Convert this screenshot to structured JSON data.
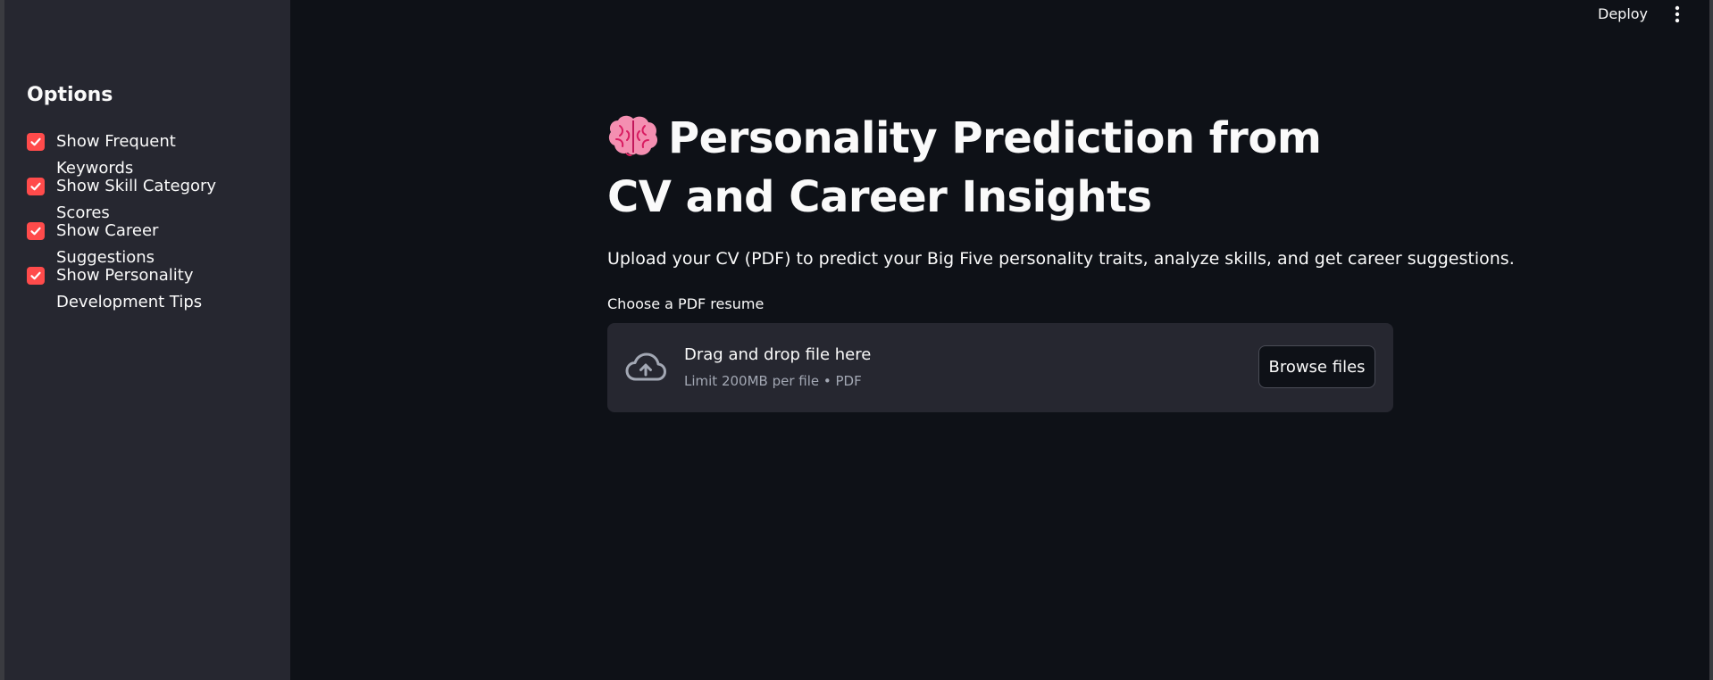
{
  "header": {
    "deploy_label": "Deploy",
    "menu_icon": "kebab-menu-icon"
  },
  "sidebar": {
    "title": "Options",
    "options": [
      {
        "label": "Show Frequent Keywords",
        "checked": true
      },
      {
        "label": "Show Skill Category Scores",
        "checked": true
      },
      {
        "label": "Show Career Suggestions",
        "checked": true
      },
      {
        "label": "Show Personality Development Tips",
        "checked": true
      }
    ]
  },
  "main": {
    "title_icon": "brain-icon",
    "title": "Personality Prediction from CV and Career Insights",
    "subtitle": "Upload your CV (PDF) to predict your Big Five personality traits, analyze skills, and get career suggestions.",
    "uploader": {
      "label": "Choose a PDF resume",
      "drop_text": "Drag and drop file here",
      "limit_text": "Limit 200MB per file • PDF",
      "browse_label": "Browse files",
      "icon": "cloud-upload-icon"
    }
  },
  "colors": {
    "background": "#0e1117",
    "sidebar": "#262730",
    "accent": "#ff4b4b",
    "text": "#fafafa",
    "muted_text": "#a3a8b4"
  }
}
